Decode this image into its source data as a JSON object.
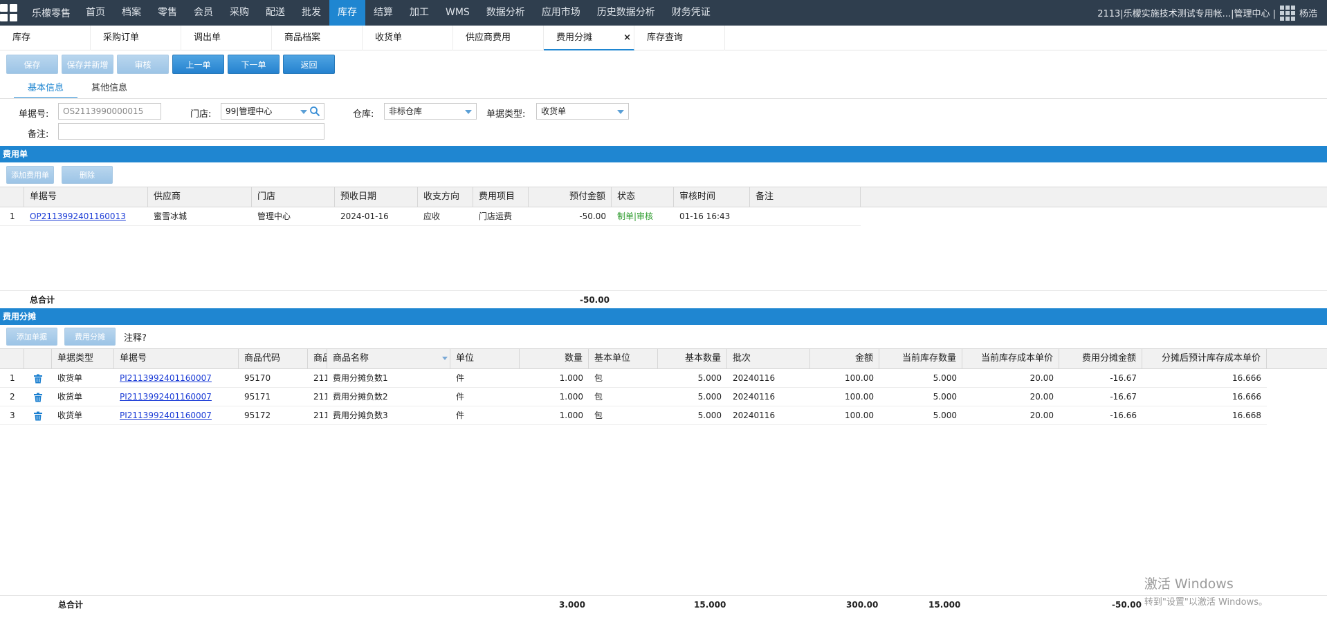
{
  "nav": {
    "brand": "乐檬零售",
    "menu": [
      "首页",
      "档案",
      "零售",
      "会员",
      "采购",
      "配送",
      "批发",
      "库存",
      "结算",
      "加工",
      "WMS",
      "数据分析",
      "应用市场",
      "历史数据分析",
      "财务凭证"
    ],
    "active_index": 7,
    "user_org": "2113|乐檬实施技术测试专用帐...|管理中心 |",
    "user_name": "杨浩"
  },
  "doc_tabs": [
    "库存",
    "采购订单",
    "调出单",
    "商品档案",
    "收货单",
    "供应商费用",
    "费用分摊",
    "库存查询"
  ],
  "doc_tab_active": 6,
  "doc_tab_close": "×",
  "toolbar": {
    "save": "保存",
    "save_new": "保存并新增",
    "audit": "审核",
    "prev": "上一单",
    "next": "下一单",
    "back": "返回"
  },
  "sub_tabs": [
    "基本信息",
    "其他信息"
  ],
  "form": {
    "doc_no_label": "单据号:",
    "doc_no_value": "OS2113990000015",
    "store_label": "门店:",
    "store_value": "99|管理中心",
    "warehouse_label": "仓库:",
    "warehouse_value": "非标仓库",
    "doc_type_label": "单据类型:",
    "doc_type_value": "收货单",
    "remark_label": "备注:",
    "remark_value": ""
  },
  "fee_section": {
    "title": "费用单",
    "add_btn": "添加费用单",
    "del_btn": "删除",
    "columns": [
      "单据号",
      "供应商",
      "门店",
      "预收日期",
      "收支方向",
      "费用项目",
      "预付金额",
      "状态",
      "审核时间",
      "备注"
    ],
    "rows": [
      {
        "idx": "1",
        "doc_no": "OP2113992401160013",
        "supplier": "蜜雪冰城",
        "store": "管理中心",
        "date": "2024-01-16",
        "direction": "应收",
        "item": "门店运费",
        "amount": "-50.00",
        "status": "制单|审核",
        "audit_time": "01-16 16:43",
        "remark": ""
      }
    ],
    "total_label": "总合计",
    "total_amount": "-50.00"
  },
  "alloc_section": {
    "title": "费用分摊",
    "add_btn": "添加单据",
    "alloc_btn": "费用分摊",
    "note": "注释?",
    "columns": [
      "单据类型",
      "单据号",
      "商品代码",
      "商品",
      "商品名称",
      "单位",
      "数量",
      "基本单位",
      "基本数量",
      "批次",
      "金额",
      "当前库存数量",
      "当前库存成本单价",
      "费用分摊金额",
      "分摊后预计库存成本单价"
    ],
    "rows": [
      {
        "idx": "1",
        "type": "收货单",
        "doc_no": "PI2113992401160007",
        "code": "95170",
        "short": "211",
        "name": "费用分摊负数1",
        "unit": "件",
        "qty": "1.000",
        "base_unit": "包",
        "base_qty": "5.000",
        "batch": "20240116",
        "amount": "100.00",
        "stock_qty": "5.000",
        "stock_cost": "20.00",
        "alloc_amt": "-16.67",
        "new_cost": "16.666"
      },
      {
        "idx": "2",
        "type": "收货单",
        "doc_no": "PI2113992401160007",
        "code": "95171",
        "short": "211",
        "name": "费用分摊负数2",
        "unit": "件",
        "qty": "1.000",
        "base_unit": "包",
        "base_qty": "5.000",
        "batch": "20240116",
        "amount": "100.00",
        "stock_qty": "5.000",
        "stock_cost": "20.00",
        "alloc_amt": "-16.67",
        "new_cost": "16.666"
      },
      {
        "idx": "3",
        "type": "收货单",
        "doc_no": "PI2113992401160007",
        "code": "95172",
        "short": "211",
        "name": "费用分摊负数3",
        "unit": "件",
        "qty": "1.000",
        "base_unit": "包",
        "base_qty": "5.000",
        "batch": "20240116",
        "amount": "100.00",
        "stock_qty": "5.000",
        "stock_cost": "20.00",
        "alloc_amt": "-16.66",
        "new_cost": "16.668"
      }
    ],
    "total_label": "总合计",
    "total_qty": "3.000",
    "total_base_qty": "15.000",
    "total_amount": "300.00",
    "total_stock_qty": "15.000",
    "total_alloc": "-50.00"
  },
  "os_watermark": {
    "line1": "激活 Windows",
    "line2": "转到\"设置\"以激活 Windows。"
  }
}
